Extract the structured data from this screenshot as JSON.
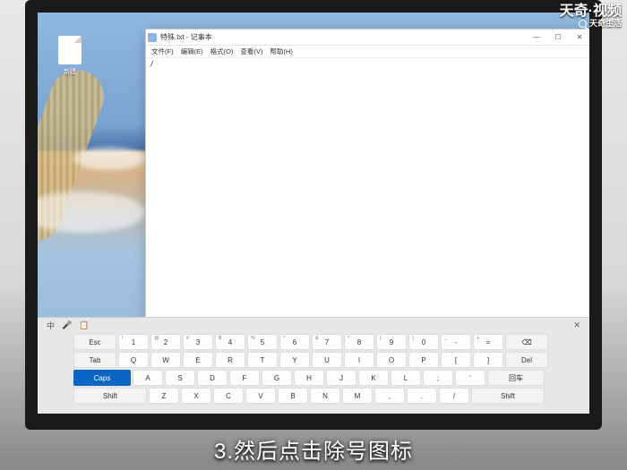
{
  "watermark": {
    "line1": "天奇·视频",
    "line2": "天奇生活"
  },
  "desktop": {
    "file_label": "新建"
  },
  "notepad": {
    "title": "特殊.txt - 记事本",
    "menu": [
      "文件(F)",
      "编辑(E)",
      "格式(O)",
      "查看(V)",
      "帮助(H)"
    ],
    "content": "/",
    "win": {
      "min": "—",
      "max": "☐",
      "close": "✕"
    }
  },
  "osk": {
    "header": {
      "lang": "中",
      "mic": "🎤",
      "clip": "📋",
      "close": "✕"
    },
    "row1": {
      "esc": "Esc",
      "nums": [
        {
          "sup": "!",
          "k": "1"
        },
        {
          "sup": "@",
          "k": "2"
        },
        {
          "sup": "#",
          "k": "3"
        },
        {
          "sup": "$",
          "k": "4"
        },
        {
          "sup": "%",
          "k": "5"
        },
        {
          "sup": "^",
          "k": "6"
        },
        {
          "sup": "&",
          "k": "7"
        },
        {
          "sup": "*",
          "k": "8"
        },
        {
          "sup": "(",
          "k": "9"
        },
        {
          "sup": ")",
          "k": "0"
        },
        {
          "sup": "_",
          "k": "-"
        },
        {
          "sup": "+",
          "k": "="
        }
      ],
      "back": "⌫"
    },
    "row2": {
      "tab": "Tab",
      "keys": [
        "Q",
        "W",
        "E",
        "R",
        "T",
        "Y",
        "U",
        "I",
        "O",
        "P",
        "[",
        "]"
      ],
      "del": "Del"
    },
    "row3": {
      "caps": "Caps",
      "keys": [
        "A",
        "S",
        "D",
        "F",
        "G",
        "H",
        "J",
        "K",
        "L",
        ";",
        "'"
      ],
      "enter": "回车"
    },
    "row4": {
      "shiftL": "Shift",
      "keys": [
        "Z",
        "X",
        "C",
        "V",
        "B",
        "N",
        "M",
        ",",
        ".",
        "/"
      ],
      "shiftR": "Shift"
    }
  },
  "caption": "3.然后点击除号图标"
}
